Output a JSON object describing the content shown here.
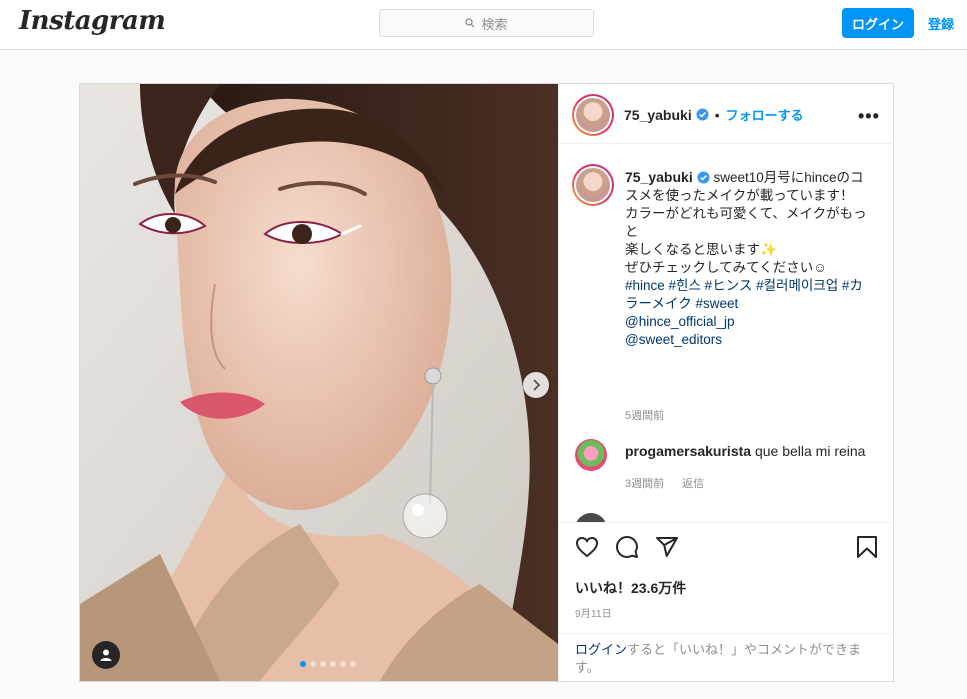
{
  "nav": {
    "logo_text": "Instagram",
    "search_placeholder": "検索",
    "login_button": "ログイン",
    "signup_link": "登録"
  },
  "post": {
    "username": "75_yabuki",
    "header_separator": "•",
    "follow_label": "フォローする",
    "more_label": "•••",
    "caption": {
      "username": "75_yabuki",
      "text_line1": "sweet10月号にhinceのコ",
      "text_line2": "スメを使ったメイクが載っています！",
      "text_line3": "カラーがどれも可愛くて、メイクがもっと",
      "text_line4": "楽しくなると思います✨",
      "text_line5": "ぜひチェックしてみてください☺︎",
      "hashtags_line1": "#hince #힌스 #ヒンス #컬러메이크업 #カ",
      "hashtags_line2": "ラーメイク #sweet",
      "mention1": "@hince_official_jp",
      "mention2": "@sweet_editors",
      "time": "5週間前"
    },
    "comments": [
      {
        "username": "progamersakurista",
        "text": "que bella mi reina",
        "time": "3週間前",
        "reply_label": "返信"
      }
    ],
    "likes": "いいね！23.6万件",
    "date": "9月11日",
    "login_prompt_link": "ログイン",
    "login_prompt_text": "すると「いいね！」やコメントができます。",
    "carousel": {
      "total_slides": 6,
      "active_slide": 1
    }
  },
  "colors": {
    "accent": "#0095f6",
    "hashtag": "#00376b",
    "muted": "#8e8e8e",
    "border": "#dbdbdb"
  },
  "icons": [
    "search-icon",
    "verified-badge-icon",
    "more-options-icon",
    "chevron-right-icon",
    "user-tag-icon",
    "heart-icon",
    "comment-icon",
    "share-icon",
    "bookmark-icon"
  ]
}
